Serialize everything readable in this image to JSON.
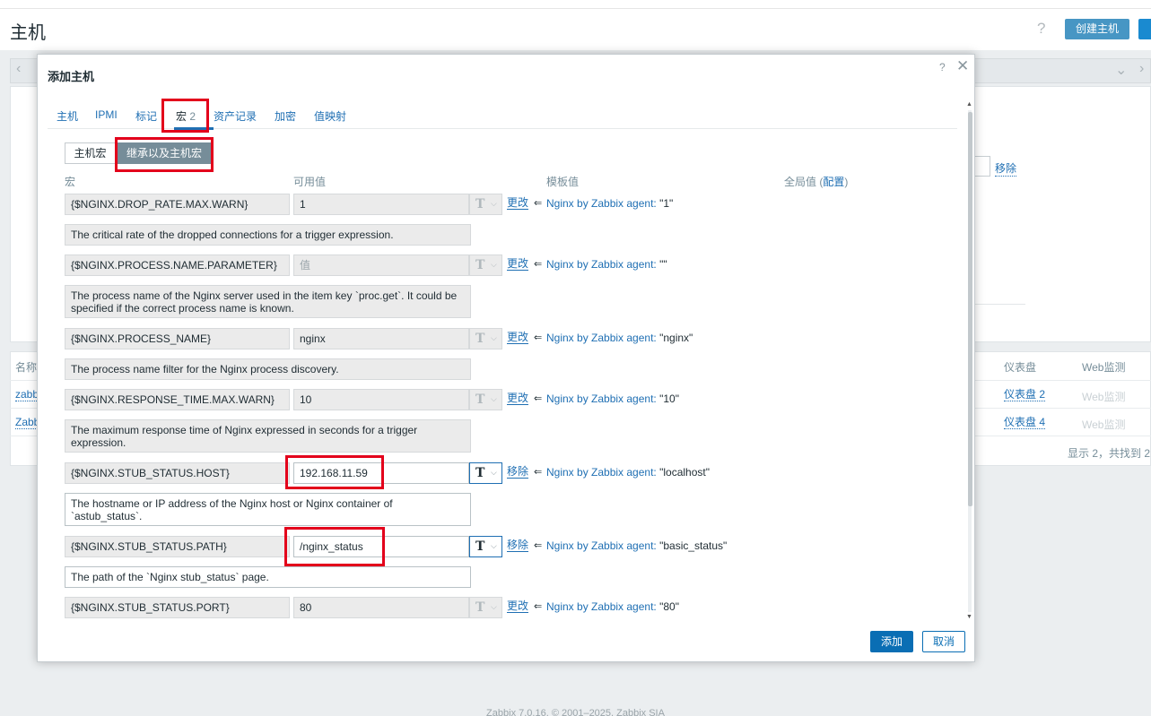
{
  "page": {
    "title": "主机",
    "help": "?",
    "create_button": "创建主机",
    "remove_link": "移除",
    "footer": "Zabbix 7.0.16. © 2001–2025, Zabbix SIA"
  },
  "table": {
    "headers": {
      "name": "名称",
      "dashboards": "仪表盘",
      "web": "Web监测"
    },
    "rows": [
      {
        "name": "zabb",
        "dashboards": "仪表盘 2",
        "web": "Web监测"
      },
      {
        "name": "Zabb",
        "dashboards": "仪表盘 4",
        "web": "Web监测"
      }
    ],
    "count_text": "显示 2，共找到 2"
  },
  "modal": {
    "title": "添加主机",
    "help": "?",
    "close": "✕",
    "tabs": [
      {
        "label": "主机"
      },
      {
        "label": "IPMI"
      },
      {
        "label": "标记"
      },
      {
        "label": "宏",
        "count": "2",
        "active": true
      },
      {
        "label": "资产记录"
      },
      {
        "label": "加密"
      },
      {
        "label": "值映射"
      }
    ],
    "segments": {
      "host_macros": "主机宏",
      "inherited": "继承以及主机宏"
    },
    "columns": {
      "macro": "宏",
      "value": "可用值",
      "template_value": "模板值",
      "global_value": "全局值 (",
      "global_config": "配置",
      "global_close": ")"
    },
    "arrow": "⇐",
    "rows": [
      {
        "macro": "{$NGINX.DROP_RATE.MAX.WARN}",
        "value": "1",
        "action": "更改",
        "template": "Nginx by Zabbix agent:",
        "template_value": "\"1\"",
        "description": "The critical rate of the dropped connections for a trigger expression."
      },
      {
        "macro": "{$NGINX.PROCESS.NAME.PARAMETER}",
        "value": "值",
        "action": "更改",
        "template": "Nginx by Zabbix agent:",
        "template_value": "\"\"",
        "description": "The process name of the Nginx server used in the item key `proc.get`. It could be specified if the correct process name is known."
      },
      {
        "macro": "{$NGINX.PROCESS_NAME}",
        "value": "nginx",
        "action": "更改",
        "template": "Nginx by Zabbix agent:",
        "template_value": "\"nginx\"",
        "description": "The process name filter for the Nginx process discovery."
      },
      {
        "macro": "{$NGINX.RESPONSE_TIME.MAX.WARN}",
        "value": "10",
        "action": "更改",
        "template": "Nginx by Zabbix agent:",
        "template_value": "\"10\"",
        "description": "The maximum response time of Nginx expressed in seconds for a trigger expression."
      },
      {
        "macro": "{$NGINX.STUB_STATUS.HOST}",
        "value": "192.168.11.59",
        "action": "移除",
        "template": "Nginx by Zabbix agent:",
        "template_value": "\"localhost\"",
        "description": "The hostname or IP address of the Nginx host or Nginx container of `astub_status`."
      },
      {
        "macro": "{$NGINX.STUB_STATUS.PATH}",
        "value": "/nginx_status",
        "action": "移除",
        "template": "Nginx by Zabbix agent:",
        "template_value": "\"basic_status\"",
        "description": "The path of the `Nginx stub_status` page."
      },
      {
        "macro": "{$NGINX.STUB_STATUS.PORT}",
        "value": "80",
        "action": "更改",
        "template": "Nginx by Zabbix agent:",
        "template_value": "\"80\""
      }
    ],
    "type_glyph": "T",
    "caret": "⌵",
    "buttons": {
      "add": "添加",
      "cancel": "取消"
    }
  },
  "colors": {
    "accent": "#0a6eb4",
    "highlight": "#e3001b"
  }
}
